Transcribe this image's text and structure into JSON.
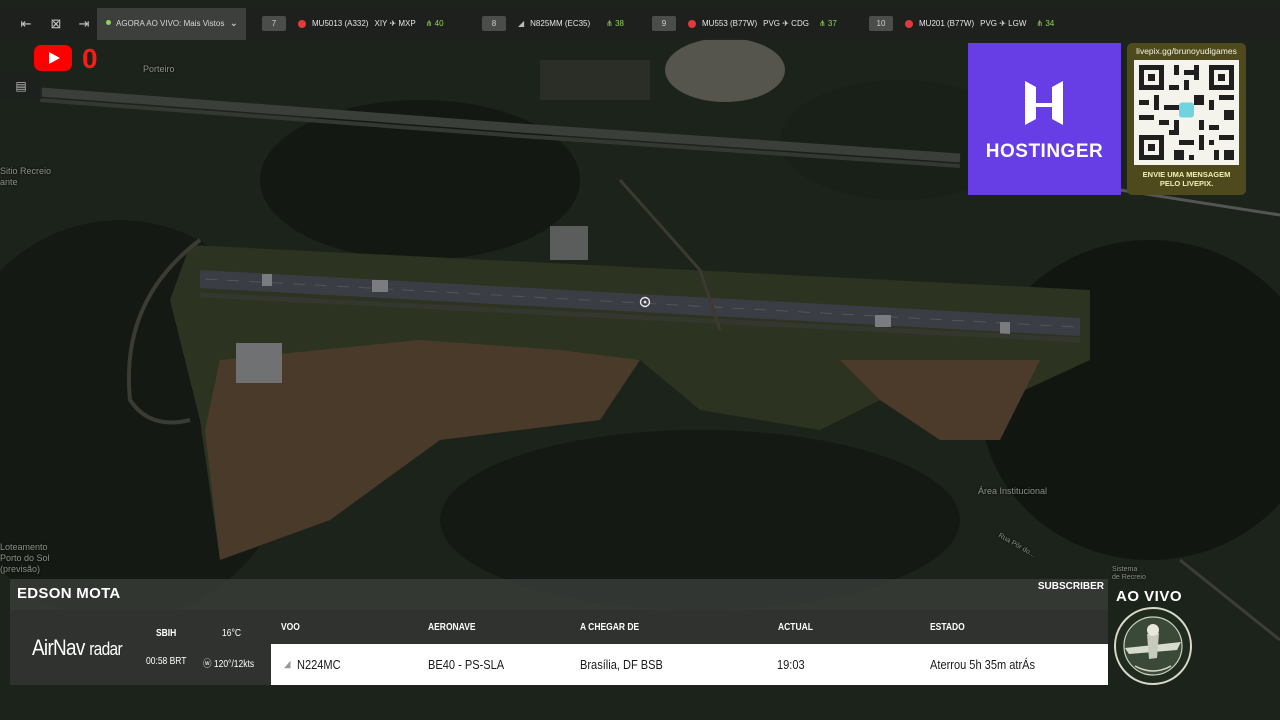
{
  "topbar": {
    "live_label": "AGORA AO VIVO: Mais Vistos",
    "flights": [
      {
        "index": "7",
        "callsign": "MU5013 (A332)",
        "route": "XIY ✈ MXP",
        "altitude": "40"
      },
      {
        "index": "8",
        "callsign": "N825MM (EC35)",
        "route": "",
        "altitude": "38"
      },
      {
        "index": "9",
        "callsign": "MU553 (B77W)",
        "route": "PVG ✈ CDG",
        "altitude": "37"
      },
      {
        "index": "10",
        "callsign": "MU201 (B77W)",
        "route": "PVG ✈ LGW",
        "altitude": "34"
      }
    ]
  },
  "youtube": {
    "count": "0"
  },
  "map_labels": {
    "porto": "Porteiro",
    "sitio_recreio": "Sitio Recreio\nante",
    "loteamento": "Loteamento\nPorto do Sol\n(previsão)",
    "area_institucional": "Área Institucional",
    "sistema_recreio": "Sistema\nde Recreio",
    "rua_por_sol": "Rua Pôr do..."
  },
  "sponsors": {
    "hostinger_name": "HOSTINGER",
    "livepix_url": "livepix.gg/brunoyudigames",
    "livepix_cta": "ENVIE UMA MENSAGEM\nPELO LIVEPIX."
  },
  "panel": {
    "streamer": "EDSON MOTA",
    "subscriber_label": "SUBSCRIBER",
    "brand_main": "AirNav",
    "brand_sub": "radar",
    "airport": "SBIH",
    "time": "00:58 BRT",
    "temperature": "16°C",
    "wind": "120°/12kts",
    "columns": {
      "flight": "VOO",
      "aircraft": "AERONAVE",
      "from": "A CHEGAR DE",
      "actual": "ACTUAL",
      "status": "ESTADO"
    },
    "row": {
      "flight": "N224MC",
      "aircraft": "BE40 - PS-SLA",
      "from": "Brasília, DF BSB",
      "actual": "19:03",
      "status": "Aterrou 5h 35m atrÁs"
    }
  },
  "live_badge": {
    "label": "AO VIVO"
  },
  "colors": {
    "hostinger_purple": "#673de6",
    "youtube_red": "#ff0000",
    "altitude_green": "#8fd65a",
    "panel_dark": "#2f322f"
  }
}
